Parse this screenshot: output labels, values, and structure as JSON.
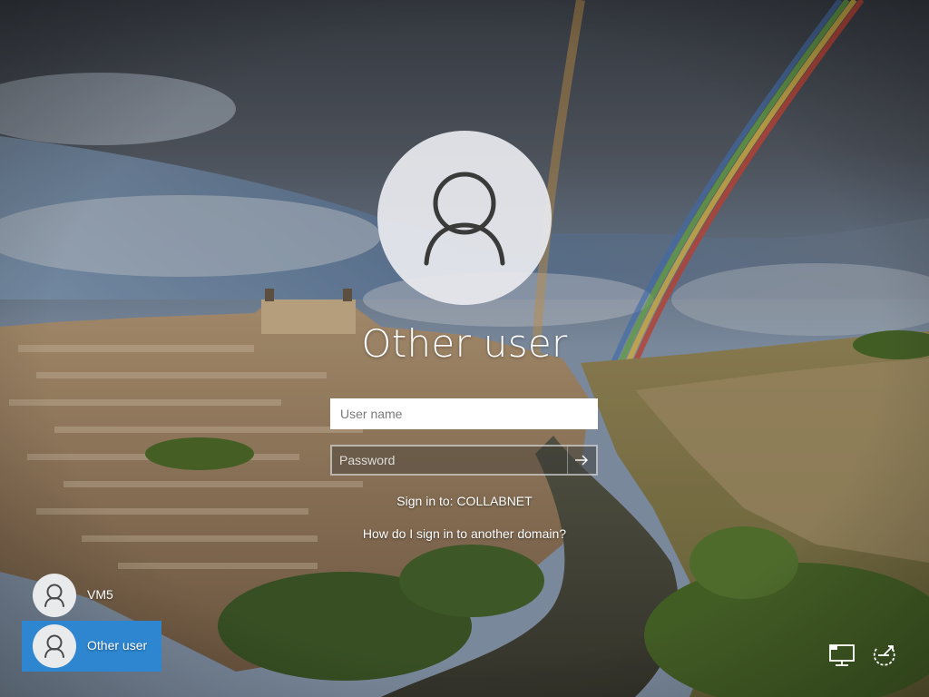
{
  "login": {
    "display_name": "Other user",
    "username_placeholder": "User name",
    "password_placeholder": "Password",
    "sign_in_to": "Sign in to: COLLABNET",
    "domain_help_link": "How do I sign in to another domain?"
  },
  "user_list": [
    {
      "label": "VM5",
      "selected": false
    },
    {
      "label": "Other user",
      "selected": true
    }
  ],
  "system_icons": {
    "network": "network-icon",
    "ease_of_access": "ease-of-access-icon",
    "submit_arrow": "arrow-right-icon",
    "user": "user-silhouette-icon"
  },
  "colors": {
    "selected_tile": "#2d86cf",
    "avatar_bg": "#e8eaee"
  }
}
